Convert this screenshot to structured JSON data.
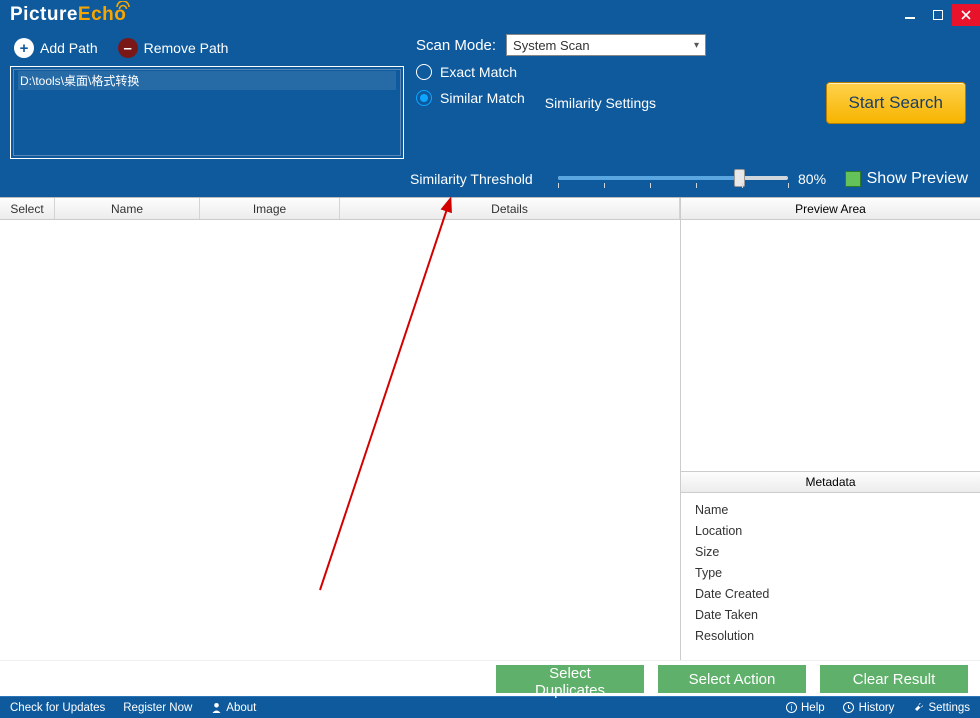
{
  "app": {
    "name_part1": "Picture",
    "name_part2": "Echo"
  },
  "toolbar": {
    "add_path": "Add Path",
    "remove_path": "Remove Path"
  },
  "paths": [
    "D:\\tools\\桌面\\格式转换"
  ],
  "scan": {
    "mode_label": "Scan Mode:",
    "selected_mode": "System Scan",
    "exact": "Exact Match",
    "similar": "Similar Match",
    "similarity_settings": "Similarity Settings",
    "start": "Start Search",
    "threshold_label": "Similarity Threshold",
    "threshold_value": "80%",
    "show_preview": "Show Preview",
    "selected_match": "similar"
  },
  "columns": {
    "select": "Select",
    "name": "Name",
    "image": "Image",
    "details": "Details"
  },
  "preview": {
    "header": "Preview Area"
  },
  "metadata": {
    "header": "Metadata",
    "fields": {
      "name": "Name",
      "location": "Location",
      "size": "Size",
      "type": "Type",
      "date_created": "Date Created",
      "date_taken": "Date Taken",
      "resolution": "Resolution"
    }
  },
  "actions": {
    "select_duplicates": "Select Duplicates",
    "select_action": "Select Action",
    "clear_result": "Clear Result"
  },
  "statusbar": {
    "updates": "Check for Updates",
    "register": "Register Now",
    "about": "About",
    "help": "Help",
    "history": "History",
    "settings": "Settings"
  },
  "colors": {
    "brand_bg": "#0e5a9c",
    "accent": "#f7b400",
    "action_green": "#5fb06a"
  }
}
